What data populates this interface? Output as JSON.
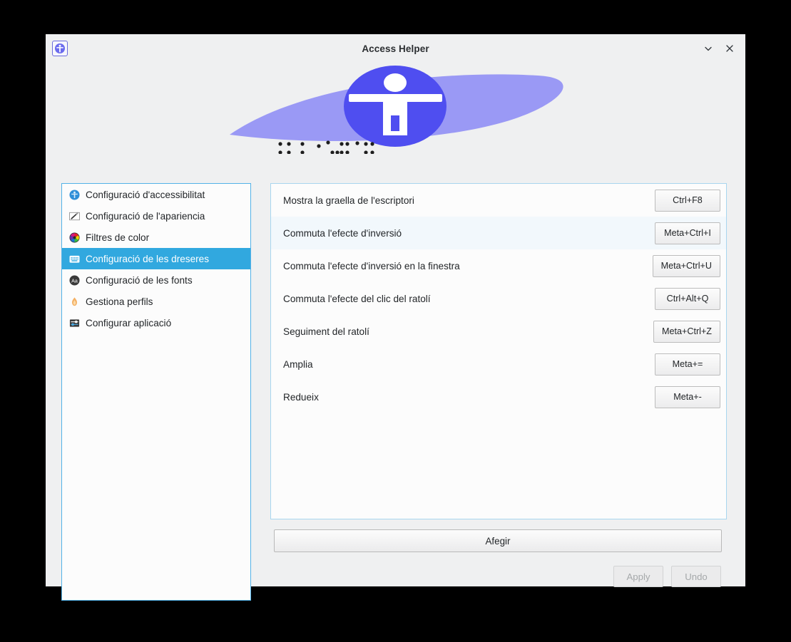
{
  "window": {
    "title": "Access Helper",
    "icon": "accessibility-app-icon",
    "controls": {
      "minimize": "chevron-down-icon",
      "close": "close-icon"
    }
  },
  "banner": {
    "icon": "accessibility-person-icon",
    "shape_color": "#9a99f5",
    "circle_color": "#4f4ef0",
    "figure_color": "#ffffff",
    "braille_left": "⠁⠃⠉⠙⠑⠋⠛",
    "braille_right": "⠊⠚⠅⠇⠍⠝⠕⠏⠟⠗"
  },
  "sidebar": {
    "items": [
      {
        "label": "Configuració d'accessibilitat",
        "icon": "accessibility-icon",
        "selected": false
      },
      {
        "label": "Configuració de l'apariencia",
        "icon": "brush-icon",
        "selected": false
      },
      {
        "label": "Filtres de color",
        "icon": "color-wheel-icon",
        "selected": false
      },
      {
        "label": "Configuració de les dreseres",
        "icon": "keyboard-icon",
        "selected": true
      },
      {
        "label": "Configuració de les fonts",
        "icon": "font-aa-icon",
        "selected": false
      },
      {
        "label": "Gestiona perfils",
        "icon": "flame-icon",
        "selected": false
      },
      {
        "label": "Configurar aplicació",
        "icon": "sliders-icon",
        "selected": false
      }
    ],
    "selected_color": "#31a8df"
  },
  "shortcuts": {
    "rows": [
      {
        "label": "Mostra la graella de l'escriptori",
        "key": "Ctrl+F8",
        "highlighted": false
      },
      {
        "label": "Commuta l'efecte d'inversió",
        "key": "Meta+Ctrl+I",
        "highlighted": true
      },
      {
        "label": "Commuta l'efecte d'inversió en la finestra",
        "key": "Meta+Ctrl+U",
        "highlighted": false
      },
      {
        "label": "Commuta l'efecte del clic del ratolí",
        "key": "Ctrl+Alt+Q",
        "highlighted": false
      },
      {
        "label": "Seguiment del ratolí",
        "key": "Meta+Ctrl+Z",
        "highlighted": false
      },
      {
        "label": "Amplia",
        "key": "Meta+=",
        "highlighted": false
      },
      {
        "label": "Redueix",
        "key": "Meta+-",
        "highlighted": false
      }
    ]
  },
  "actions": {
    "add_label": "Afegir",
    "apply_label": "Apply",
    "undo_label": "Undo"
  }
}
